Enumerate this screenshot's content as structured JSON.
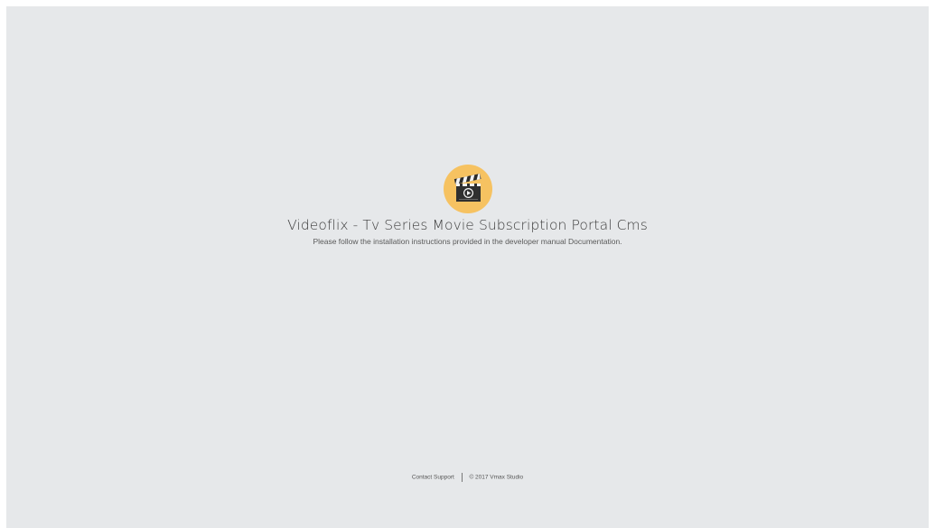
{
  "main": {
    "logo_icon": "clapperboard-play-icon",
    "title": "Videoflix - Tv Series Movie Subscription Portal Cms",
    "subtitle": "Please follow the installation instructions provided in the developer manual Documentation."
  },
  "footer": {
    "contact_label": "Contact Support",
    "copyright": "© 2017 Vmax Studio"
  },
  "colors": {
    "background": "#e6e8ea",
    "logo_circle": "#f6c261"
  }
}
